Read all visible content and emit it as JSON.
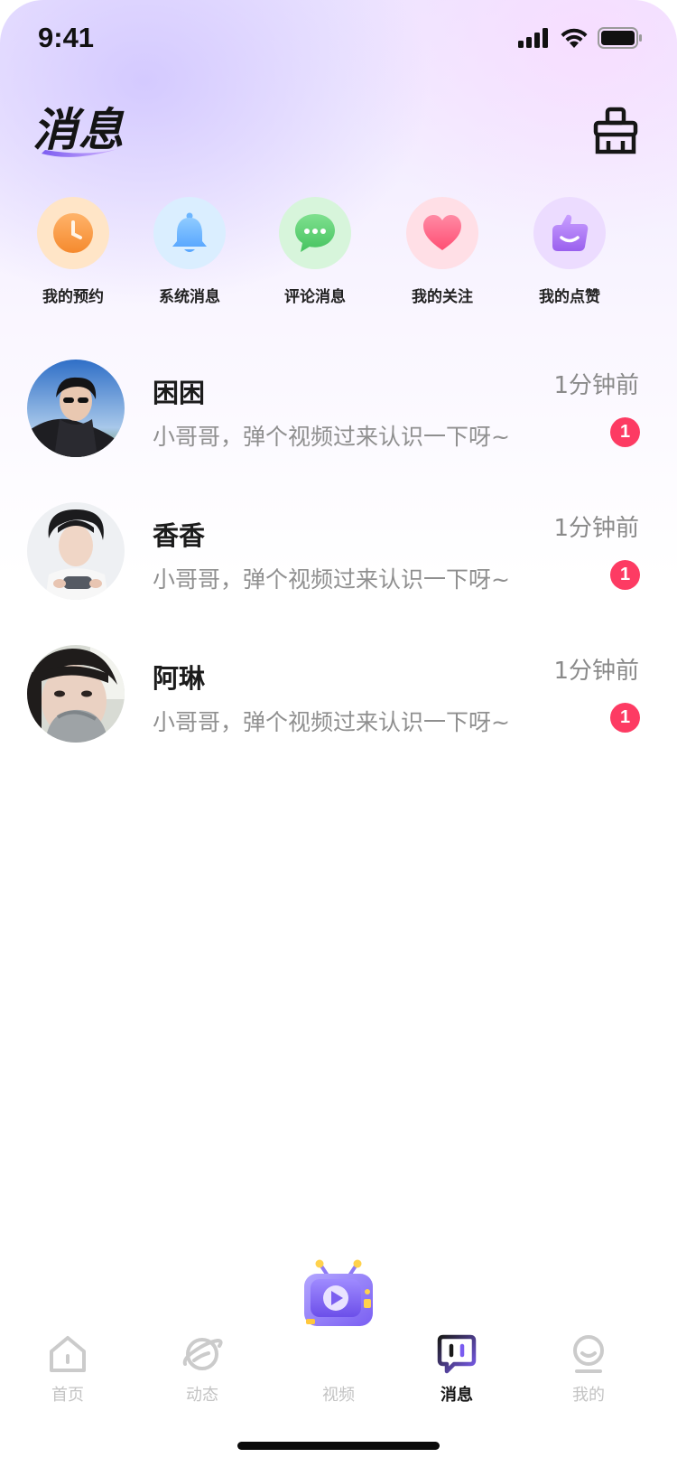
{
  "status_bar": {
    "time": "9:41"
  },
  "header": {
    "title": "消息",
    "clean_icon": "broom-icon"
  },
  "quick_entries": [
    {
      "label": "我的预约",
      "icon": "clock-icon",
      "color": "#fb9a4a"
    },
    {
      "label": "系统消息",
      "icon": "bell-icon",
      "color": "#6ab6ff"
    },
    {
      "label": "评论消息",
      "icon": "chat-bubble-icon",
      "color": "#57d16f"
    },
    {
      "label": "我的关注",
      "icon": "heart-icon",
      "color": "#ff6b8a"
    },
    {
      "label": "我的点赞",
      "icon": "thumbs-up-icon",
      "color": "#b683f4"
    }
  ],
  "messages": [
    {
      "name": "困困",
      "time": "1分钟前",
      "preview": "小哥哥，弹个视频过来认识一下呀~",
      "badge": "1"
    },
    {
      "name": "香香",
      "time": "1分钟前",
      "preview": "小哥哥，弹个视频过来认识一下呀~",
      "badge": "1"
    },
    {
      "name": "阿琳",
      "time": "1分钟前",
      "preview": "小哥哥，弹个视频过来认识一下呀~",
      "badge": "1"
    }
  ],
  "tab_bar": {
    "tabs": [
      {
        "label": "首页",
        "icon": "home-icon"
      },
      {
        "label": "动态",
        "icon": "planet-icon"
      },
      {
        "label": "视频",
        "icon": "tv-play-icon"
      },
      {
        "label": "消息",
        "icon": "message-icon",
        "active": true
      },
      {
        "label": "我的",
        "icon": "profile-icon"
      }
    ]
  },
  "colors": {
    "badge": "#fd3b63",
    "accent": "#8b6bf5"
  }
}
